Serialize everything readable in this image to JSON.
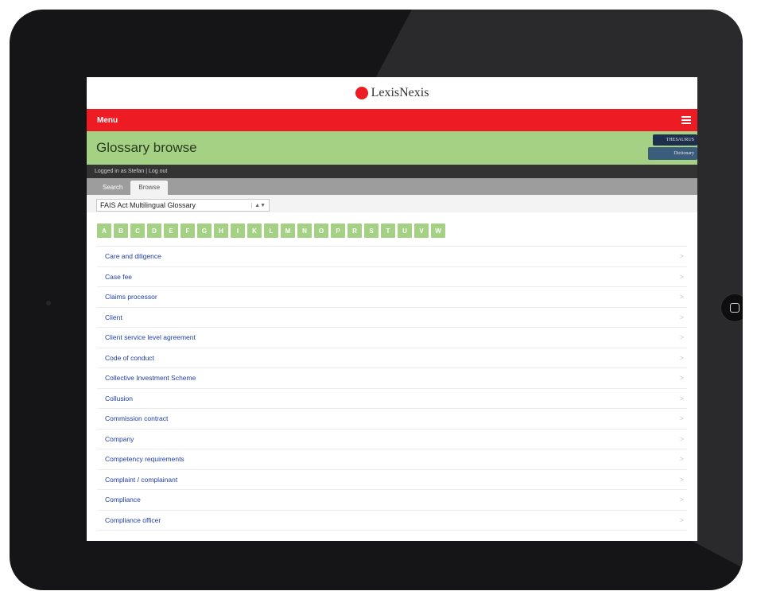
{
  "header": {
    "brand": "LexisNexis"
  },
  "menubar": {
    "menu_label": "Menu",
    "menu_icon": "hamburger-icon"
  },
  "page": {
    "title": "Glossary browse",
    "books": {
      "top_label": "THESAURUS",
      "bottom_label": "Dictionary"
    }
  },
  "session": {
    "status": "Logged in as Stefan | Log out"
  },
  "tabs": [
    {
      "label": "Search",
      "active": false
    },
    {
      "label": "Browse",
      "active": true
    }
  ],
  "glossary_select": {
    "value": "FAIS Act Multilingual Glossary",
    "arrows": "▲▼"
  },
  "letters": [
    "A",
    "B",
    "C",
    "D",
    "E",
    "F",
    "G",
    "H",
    "I",
    "K",
    "L",
    "M",
    "N",
    "O",
    "P",
    "R",
    "S",
    "T",
    "U",
    "V",
    "W"
  ],
  "terms": [
    "Care and diligence",
    "Case fee",
    "Claims processor",
    "Client",
    "Client service level agreement",
    "Code of conduct",
    "Collective Investment Scheme",
    "Collusion",
    "Commission contract",
    "Company",
    "Competency requirements",
    "Complaint / complainant",
    "Compliance",
    "Compliance officer"
  ],
  "chevron": ">",
  "colors": {
    "brand_red": "#ed1c24",
    "accent_green": "#a5d184",
    "link_blue": "#1f3ea5"
  }
}
